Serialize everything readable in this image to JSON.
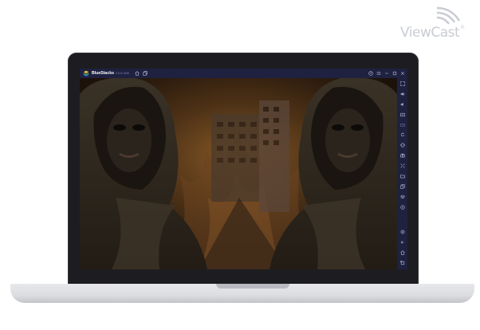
{
  "watermark": {
    "brand": "ViewCast",
    "reg_mark": "®"
  },
  "app": {
    "name": "BlueStacks",
    "version": "4.0.0.1040"
  },
  "titlebar": {
    "left_icons": [
      "home-icon",
      "multi-instance-icon"
    ],
    "right_icons": [
      "help-icon",
      "menu-icon",
      "minimize-icon",
      "restore-icon",
      "close-icon"
    ]
  },
  "sidebar": {
    "top_icons": [
      "fullscreen-icon",
      "volume-up-icon",
      "volume-down-icon",
      "video-record-icon",
      "keymapping-icon",
      "rotate-icon",
      "shake-icon",
      "screenshot-icon",
      "multi-instance-icon",
      "folder-icon",
      "copy-icon",
      "layers-icon",
      "location-icon"
    ],
    "bottom_icons": [
      "settings-icon",
      "back-icon",
      "home-icon",
      "recent-apps-icon"
    ]
  },
  "colors": {
    "chrome": "#1e2140",
    "bezel": "#1d1d21",
    "accent": "#5b8cff"
  }
}
